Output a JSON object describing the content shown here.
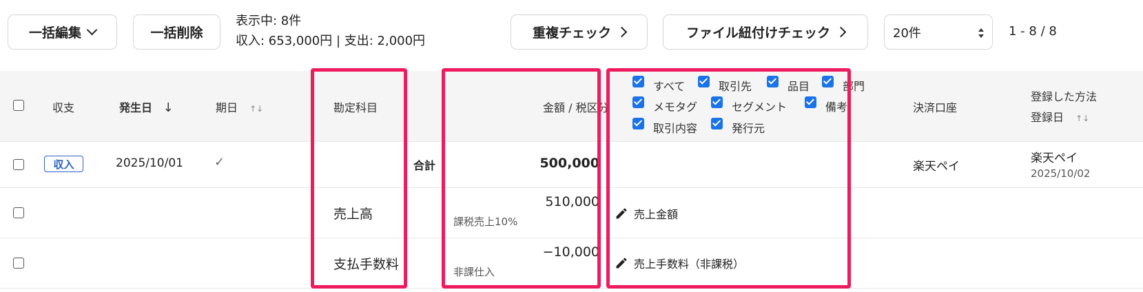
{
  "toolbar": {
    "bulk_edit": "一括編集",
    "bulk_delete": "一括削除",
    "summary_count": "表示中: 8件",
    "summary_amounts": "収入: 653,000円 | 支出: 2,000円",
    "duplicate_check": "重複チェック",
    "file_link_check": "ファイル紐付けチェック",
    "page_size": "20件",
    "pagination": "1 - 8 / 8"
  },
  "columns": {
    "type": "収支",
    "date": "発生日",
    "date_sort_icon": "↓",
    "period": "期日",
    "period_sort_icon": "↑↓",
    "account": "勘定科目",
    "amount": "金額 / 税区分",
    "payment_account": "決済口座",
    "registered_method": "登録した方法",
    "registered_date": "登録日",
    "registered_sort_icon": "↑↓"
  },
  "detail_options": [
    {
      "label": "すべて",
      "checked": true
    },
    {
      "label": "取引先",
      "checked": true
    },
    {
      "label": "品目",
      "checked": true
    },
    {
      "label": "部門",
      "checked": true
    },
    {
      "label": "メモタグ",
      "checked": true
    },
    {
      "label": "セグメント",
      "checked": true
    },
    {
      "label": "備考",
      "checked": true
    },
    {
      "label": "取引内容",
      "checked": true
    },
    {
      "label": "発行元",
      "checked": true
    }
  ],
  "rows": [
    {
      "type_badge": "収入",
      "date": "2025/10/01",
      "period_check": "✓",
      "total_label": "合計",
      "amount": "500,000",
      "payment_account": "楽天ペイ",
      "registered_method": "楽天ペイ",
      "registered_date": "2025/10/02"
    },
    {
      "account": "売上高",
      "amount": "510,000",
      "tax_category": "課税売上10%",
      "description": "売上金額"
    },
    {
      "account": "支払手数料",
      "amount": "−10,000",
      "tax_category": "非課仕入",
      "description": "売上手数料（非課税）"
    }
  ],
  "colors": {
    "highlight": "#ee1b5e",
    "checkbox": "#1a73e8",
    "badge": "#2962c6",
    "header_bg": "#f6f5f6"
  }
}
